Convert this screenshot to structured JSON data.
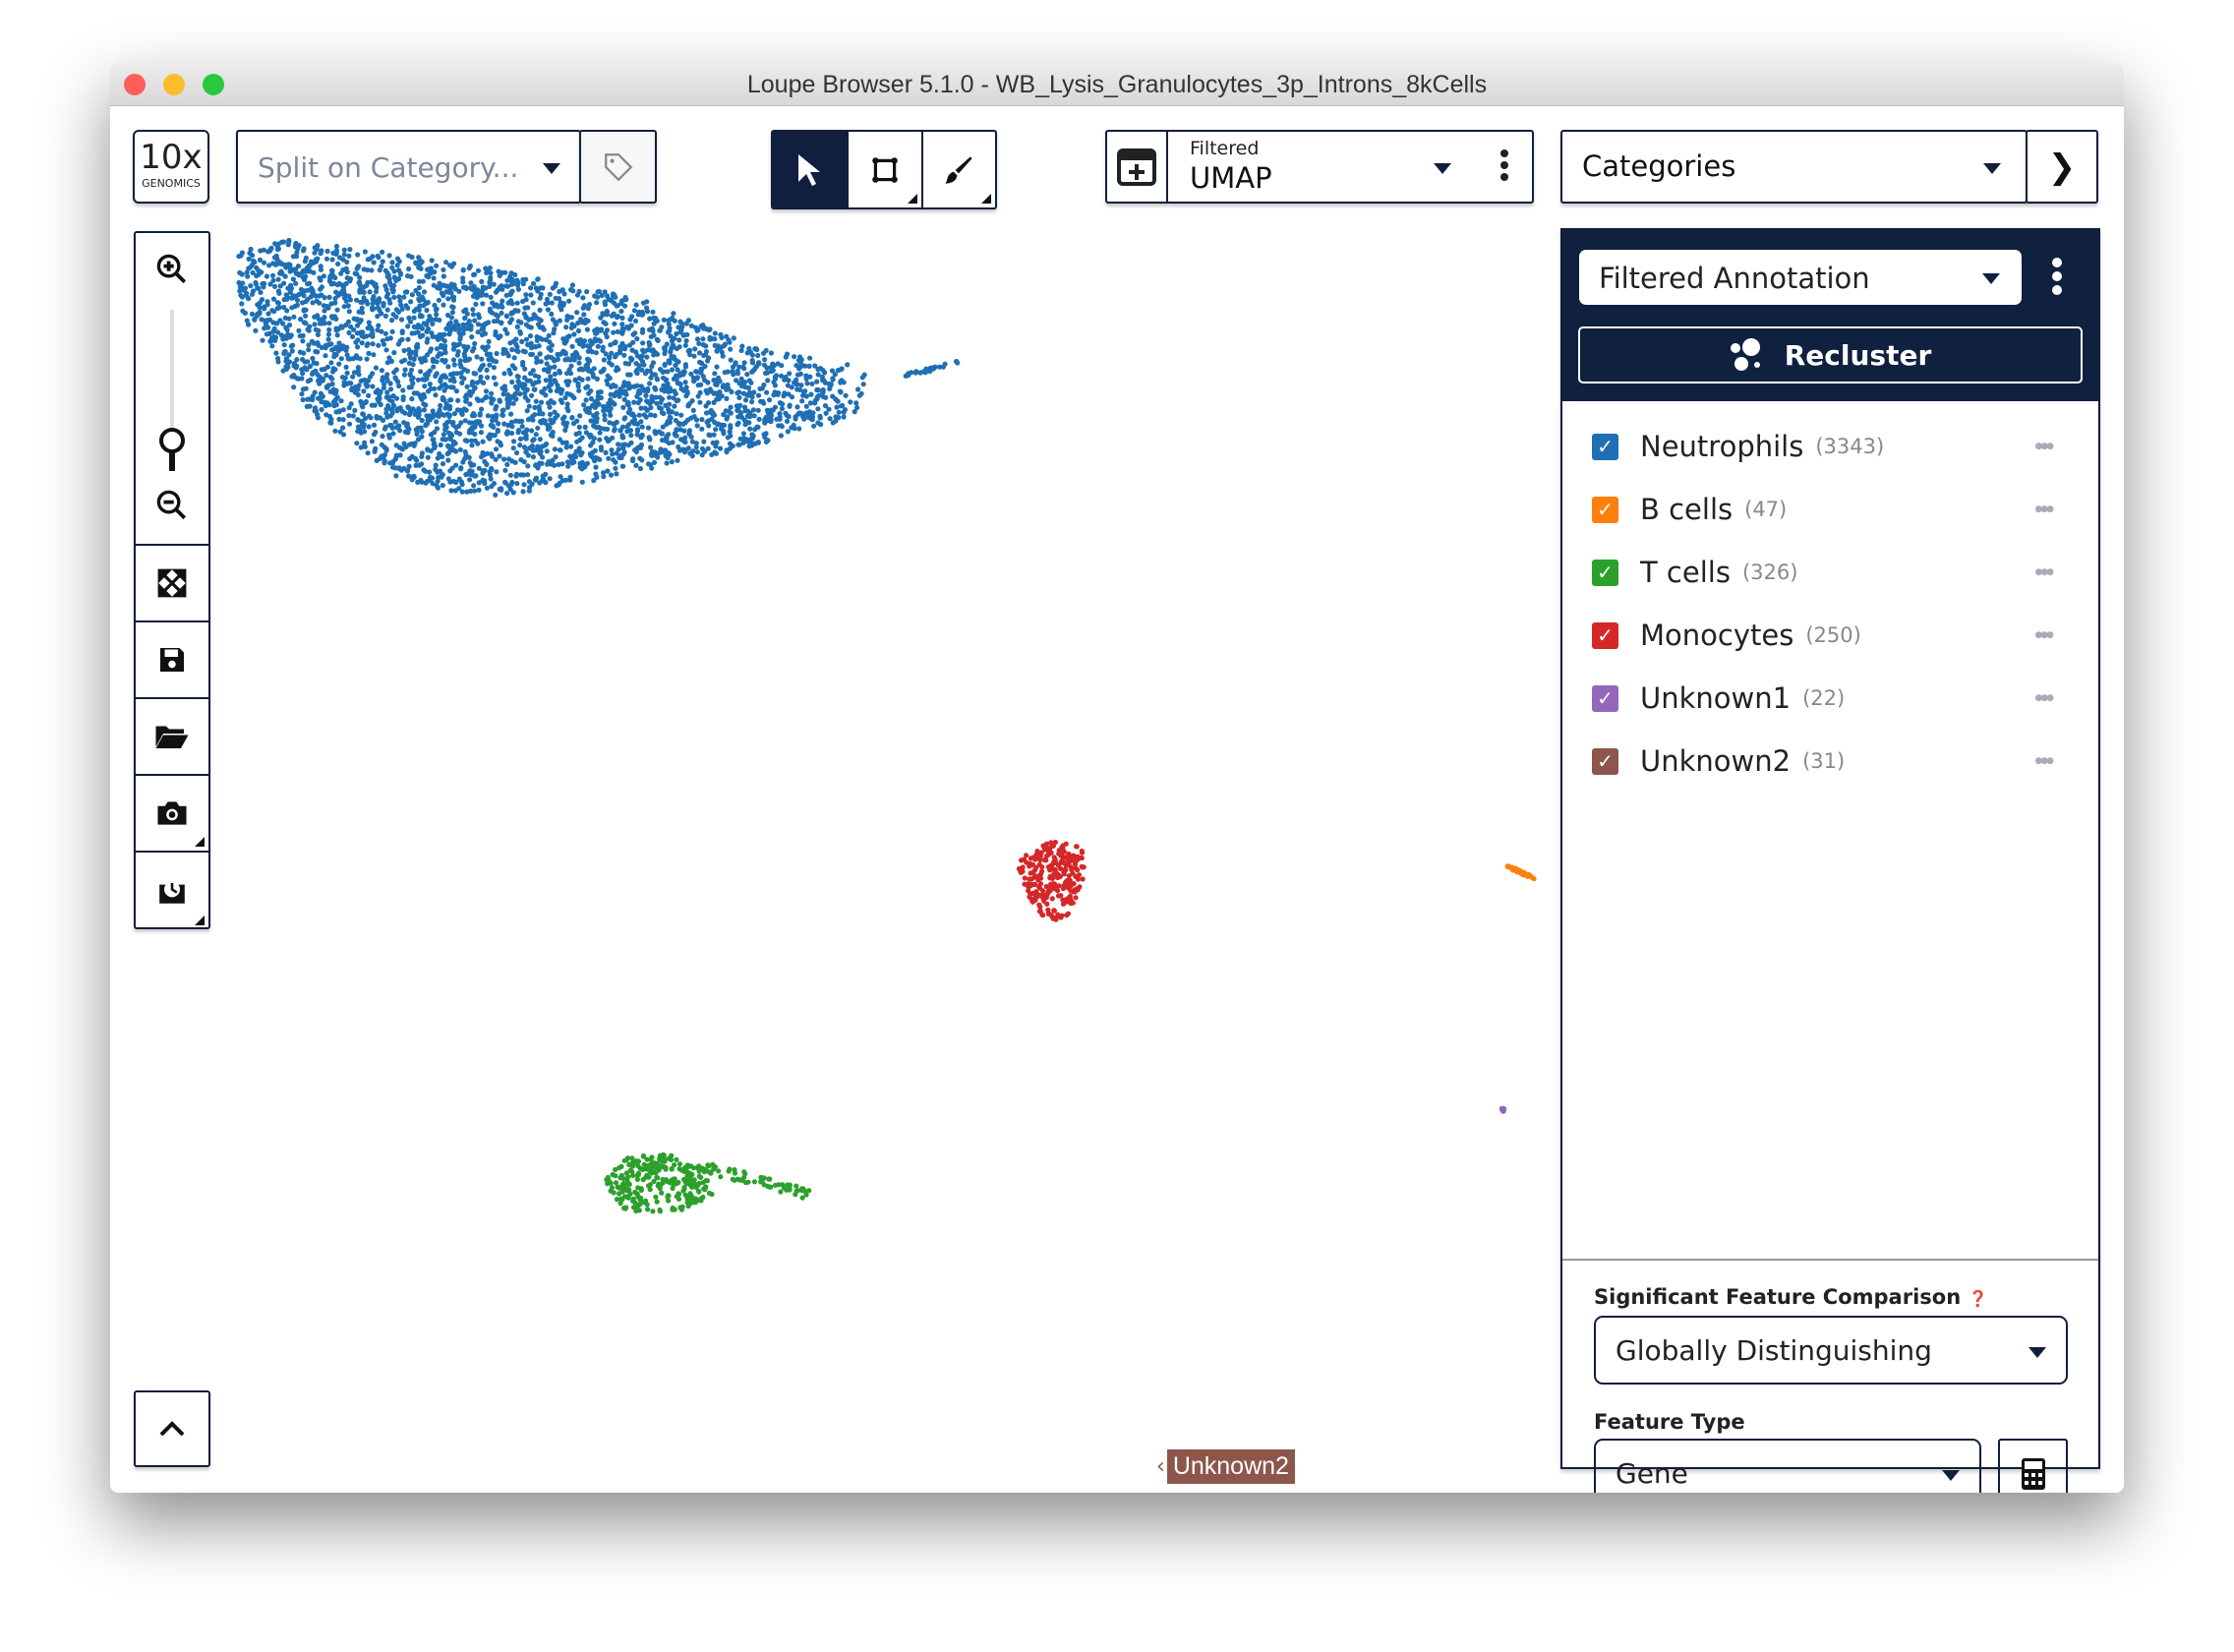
{
  "window": {
    "title": "Loupe Browser 5.1.0 - WB_Lysis_Granulocytes_3p_Introns_8kCells"
  },
  "toolbar": {
    "logo": {
      "top": "10x",
      "bottom": "GENOMICS"
    },
    "split_dropdown": {
      "placeholder": "Split on Category..."
    },
    "tag_icon": "tag-icon",
    "tools": [
      {
        "name": "select",
        "icon": "cursor-icon",
        "active": true
      },
      {
        "name": "lasso",
        "icon": "rectangle-select-icon",
        "active": false
      },
      {
        "name": "brush",
        "icon": "brush-icon",
        "active": false
      }
    ],
    "projection": {
      "small": "Filtered",
      "value": "UMAP"
    },
    "view": {
      "value": "Categories"
    }
  },
  "sidebar": {
    "tools": [
      "zoom-in-icon",
      "zoom-slider",
      "zoom-out-icon",
      "fit-icon",
      "save-icon",
      "open-folder-icon",
      "camera-icon",
      "export-icon"
    ]
  },
  "panel": {
    "category_dropdown": "Filtered Annotation",
    "recluster_label": "Recluster",
    "clusters": [
      {
        "label": "Neutrophils",
        "count": "(3343)",
        "n": 3343,
        "color": "#1f6fb4"
      },
      {
        "label": "B cells",
        "count": "(47)",
        "n": 47,
        "color": "#ff7f0e"
      },
      {
        "label": "T cells",
        "count": "(326)",
        "n": 326,
        "color": "#2ca02c"
      },
      {
        "label": "Monocytes",
        "count": "(250)",
        "n": 250,
        "color": "#d62728"
      },
      {
        "label": "Unknown1",
        "count": "(22)",
        "n": 22,
        "color": "#9467bd"
      },
      {
        "label": "Unknown2",
        "count": "(31)",
        "n": 31,
        "color": "#8c564b"
      }
    ],
    "sig_label": "Significant Feature Comparison",
    "sig_value": "Globally Distinguishing",
    "feature_label": "Feature Type",
    "feature_value": "Gene"
  },
  "plot": {
    "offscreen_label": "Unknown2",
    "offscreen_color": "#8c564b"
  }
}
